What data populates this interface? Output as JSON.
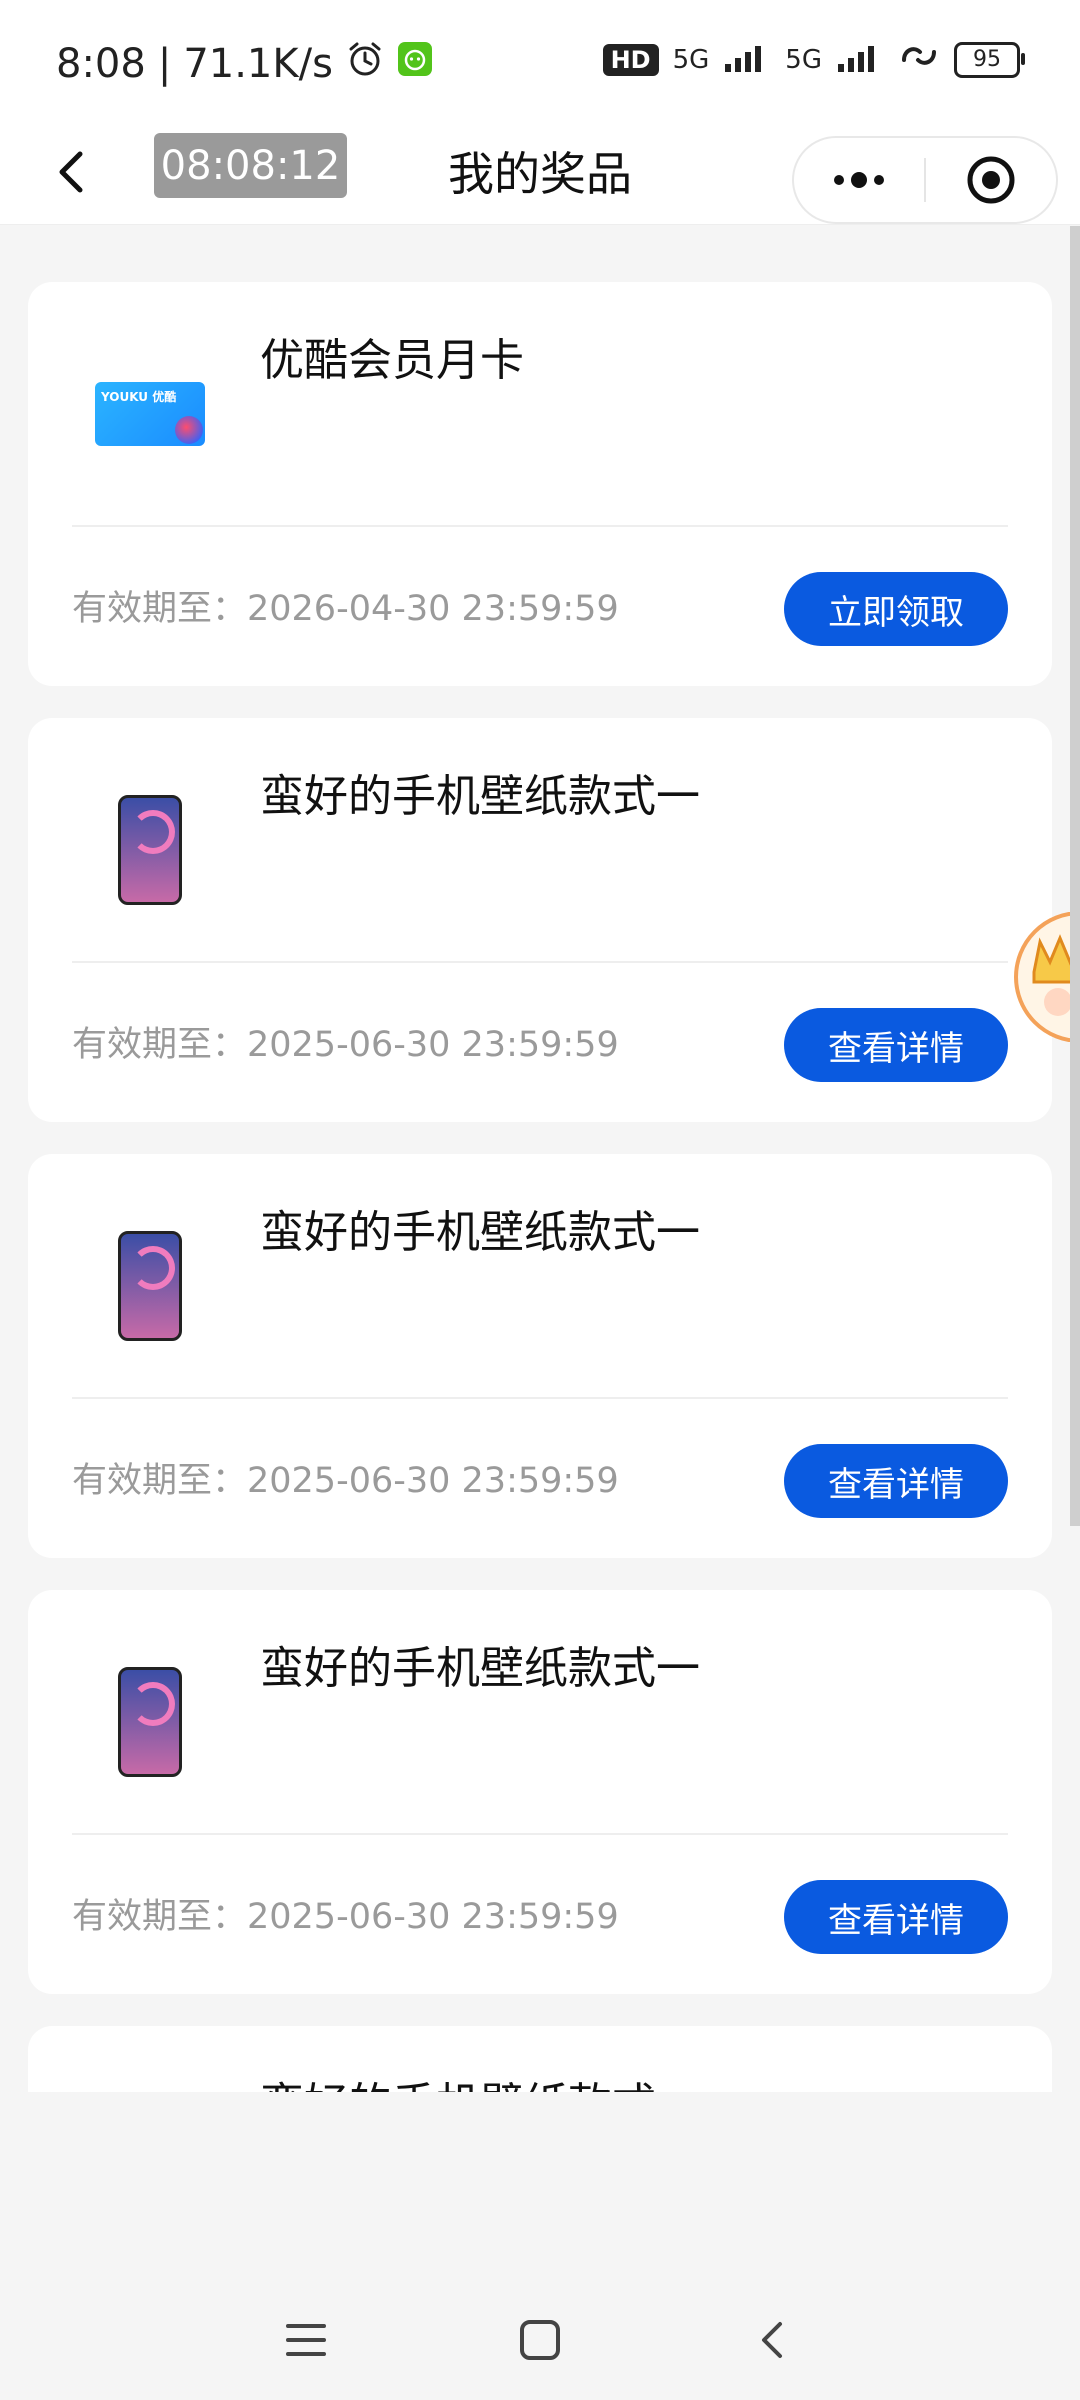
{
  "status_bar": {
    "time": "8:08",
    "separator": "|",
    "network_speed": "71.1K/s",
    "hd_label": "HD",
    "signal_label_1": "5G",
    "signal_label_2": "5G",
    "battery": "95"
  },
  "nav": {
    "timer": "08:08:12",
    "title": "我的奖品"
  },
  "prizes": [
    {
      "name": "优酷会员月卡",
      "expiry": "有效期至：2026-04-30 23:59:59",
      "button": "立即领取",
      "image": "youku-card",
      "card_logo_text": "YOUKU 优酷"
    },
    {
      "name": "蛮好的手机壁纸款式一",
      "expiry": "有效期至：2025-06-30 23:59:59",
      "button": "查看详情",
      "image": "phone-wallpaper"
    },
    {
      "name": "蛮好的手机壁纸款式一",
      "expiry": "有效期至：2025-06-30 23:59:59",
      "button": "查看详情",
      "image": "phone-wallpaper"
    },
    {
      "name": "蛮好的手机壁纸款式一",
      "expiry": "有效期至：2025-06-30 23:59:59",
      "button": "查看详情",
      "image": "phone-wallpaper"
    },
    {
      "name": "蛮好的手机壁纸款式一",
      "expiry": "",
      "button": "",
      "image": "phone-wallpaper"
    }
  ],
  "colors": {
    "accent": "#0a5ae0",
    "background": "#f5f5f5",
    "muted_text": "#9a9a9a"
  },
  "icons": {
    "back": "chevron-left-icon",
    "more": "more-dots-icon",
    "close": "target-close-icon",
    "menu": "menu-lines-icon",
    "home": "square-home-icon",
    "system_back": "chevron-back-icon"
  }
}
